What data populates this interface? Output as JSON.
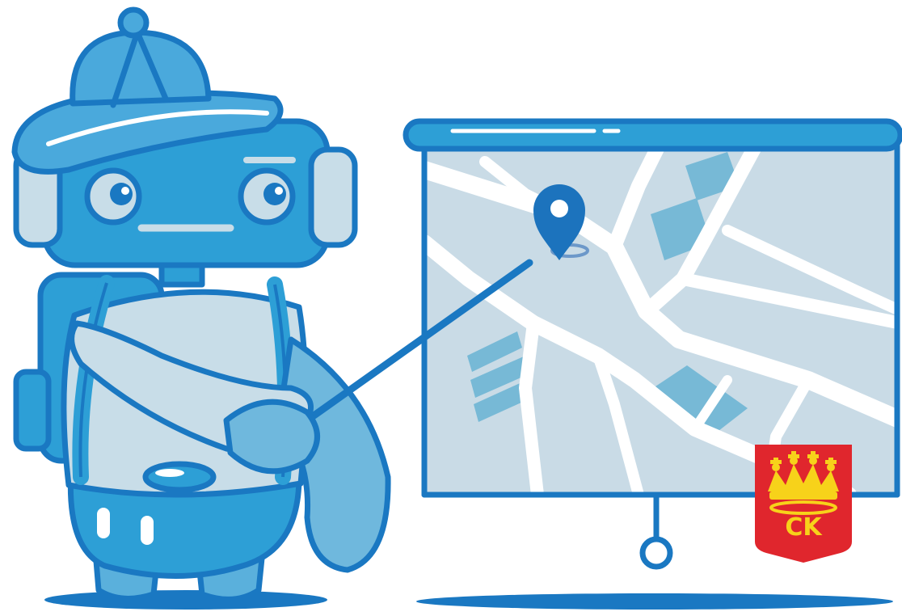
{
  "colors": {
    "outline": "#1a78c2",
    "robot_blue": "#2d9fd6",
    "robot_light": "#c8dde8",
    "hat_blue": "#4aa9dc",
    "map_bg": "#c9dbe6",
    "map_road": "#ffffff",
    "map_block": "#77b9d6",
    "pin": "#1c73bd",
    "crest_red": "#e0262d",
    "crest_gold": "#f7d21a"
  },
  "icons": {
    "pin": "map-pin-icon",
    "crest": "city-crest-icon"
  },
  "crest": {
    "letters": "CK"
  }
}
